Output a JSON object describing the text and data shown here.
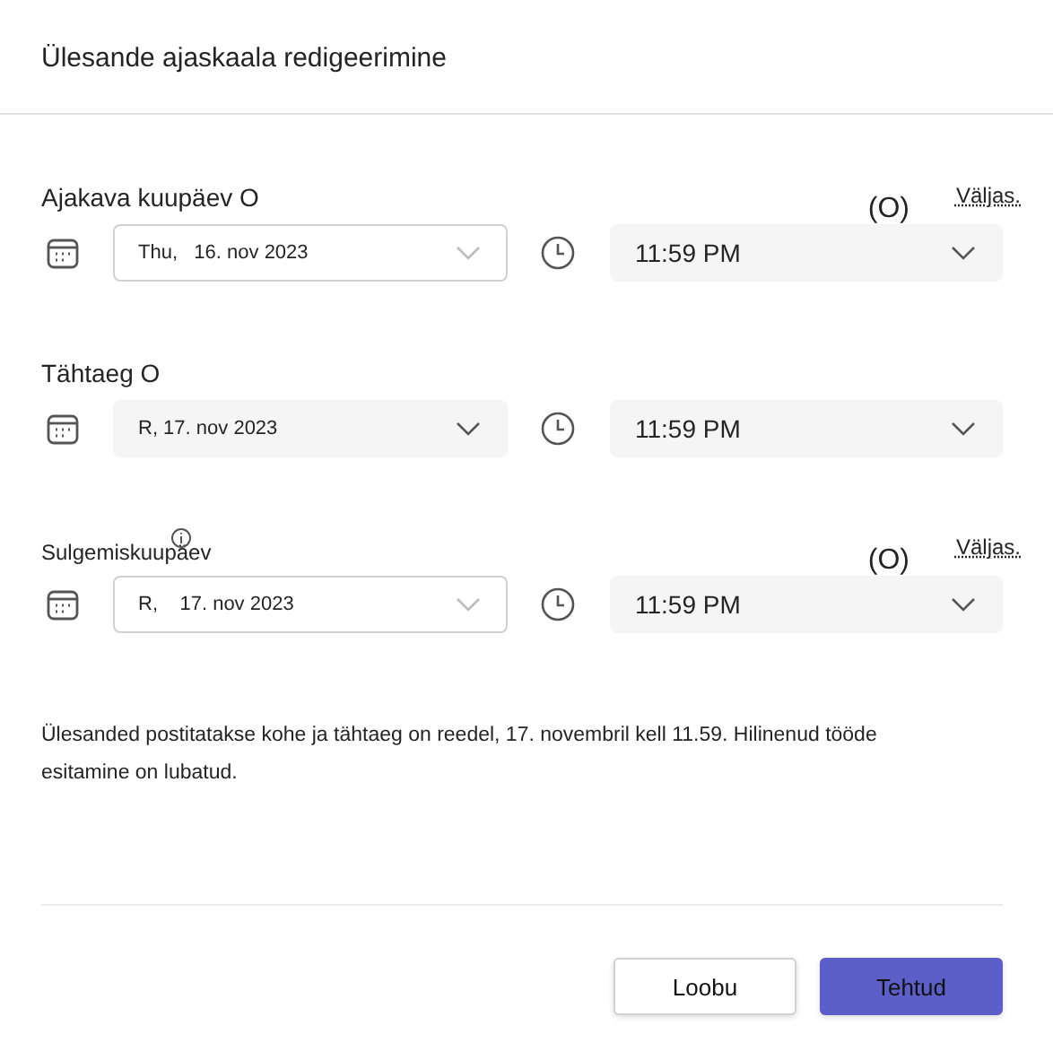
{
  "dialog": {
    "title": "Ülesande ajaskaala redigeerimine"
  },
  "sections": [
    {
      "label": "Ajakava kuupäev O",
      "info_icon": false,
      "status": "(O)",
      "toggle_label": "Väljas.",
      "date": {
        "value": "Thu,   16. nov 2023",
        "kind": "outlined"
      },
      "time": {
        "value": "11:59 PM"
      }
    },
    {
      "label": "Tähtaeg O",
      "info_icon": false,
      "date": {
        "value": "R, 17. nov 2023",
        "kind": "filled"
      },
      "time": {
        "value": "11:59 PM"
      }
    },
    {
      "label": "Sulgemiskuupäev",
      "info_icon": true,
      "status": "(O)",
      "toggle_label": "Väljas.",
      "date": {
        "value": "R,    17. nov 2023",
        "kind": "outlined"
      },
      "time": {
        "value": "11:59 PM"
      }
    }
  ],
  "summary": "Ülesanded postitatakse kohe ja tähtaeg on reedel, 17. novembril kell 11.59. Hilinenud tööde esitamine on lubatud.",
  "buttons": [
    {
      "label": "Loobu",
      "kind": "secondary"
    },
    {
      "label": "Tehtud",
      "kind": "primary"
    }
  ]
}
